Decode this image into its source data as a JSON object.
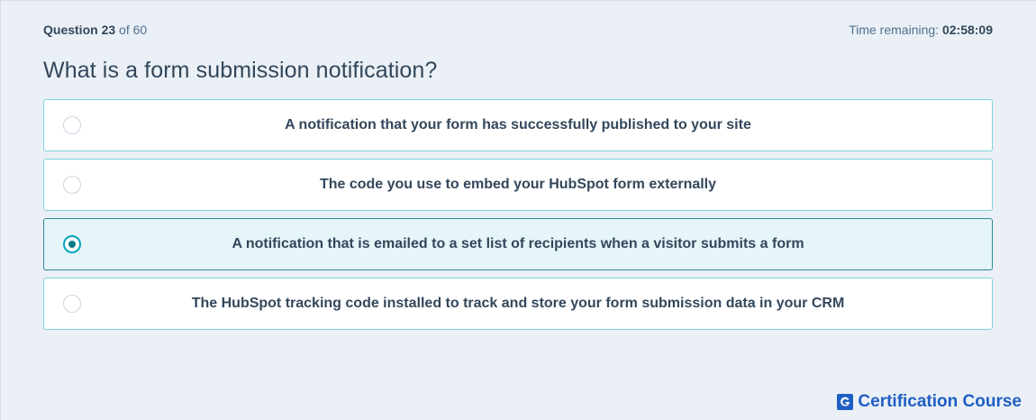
{
  "header": {
    "question_prefix": "Question",
    "question_number": "23",
    "question_of": "of 60",
    "time_label": "Time remaining:",
    "time_value": "02:58:09"
  },
  "question": {
    "text": "What is a form submission notification?"
  },
  "options": [
    {
      "label": "A notification that your form has successfully published to your site",
      "selected": false
    },
    {
      "label": "The code you use to embed your HubSpot form externally",
      "selected": false
    },
    {
      "label": "A notification that is emailed to a set list of recipients when a visitor submits a form",
      "selected": true
    },
    {
      "label": "The HubSpot tracking code installed to track and store your form submission data in your CRM",
      "selected": false
    }
  ],
  "brand": {
    "logo_letter": "G",
    "name": "Certification Course"
  },
  "colors": {
    "background": "#eaf0f6",
    "option_border": "#7fd1de",
    "selected_background": "#e5f5f8",
    "radio_accent": "#00a4bd",
    "brand": "#1f5fc4"
  }
}
